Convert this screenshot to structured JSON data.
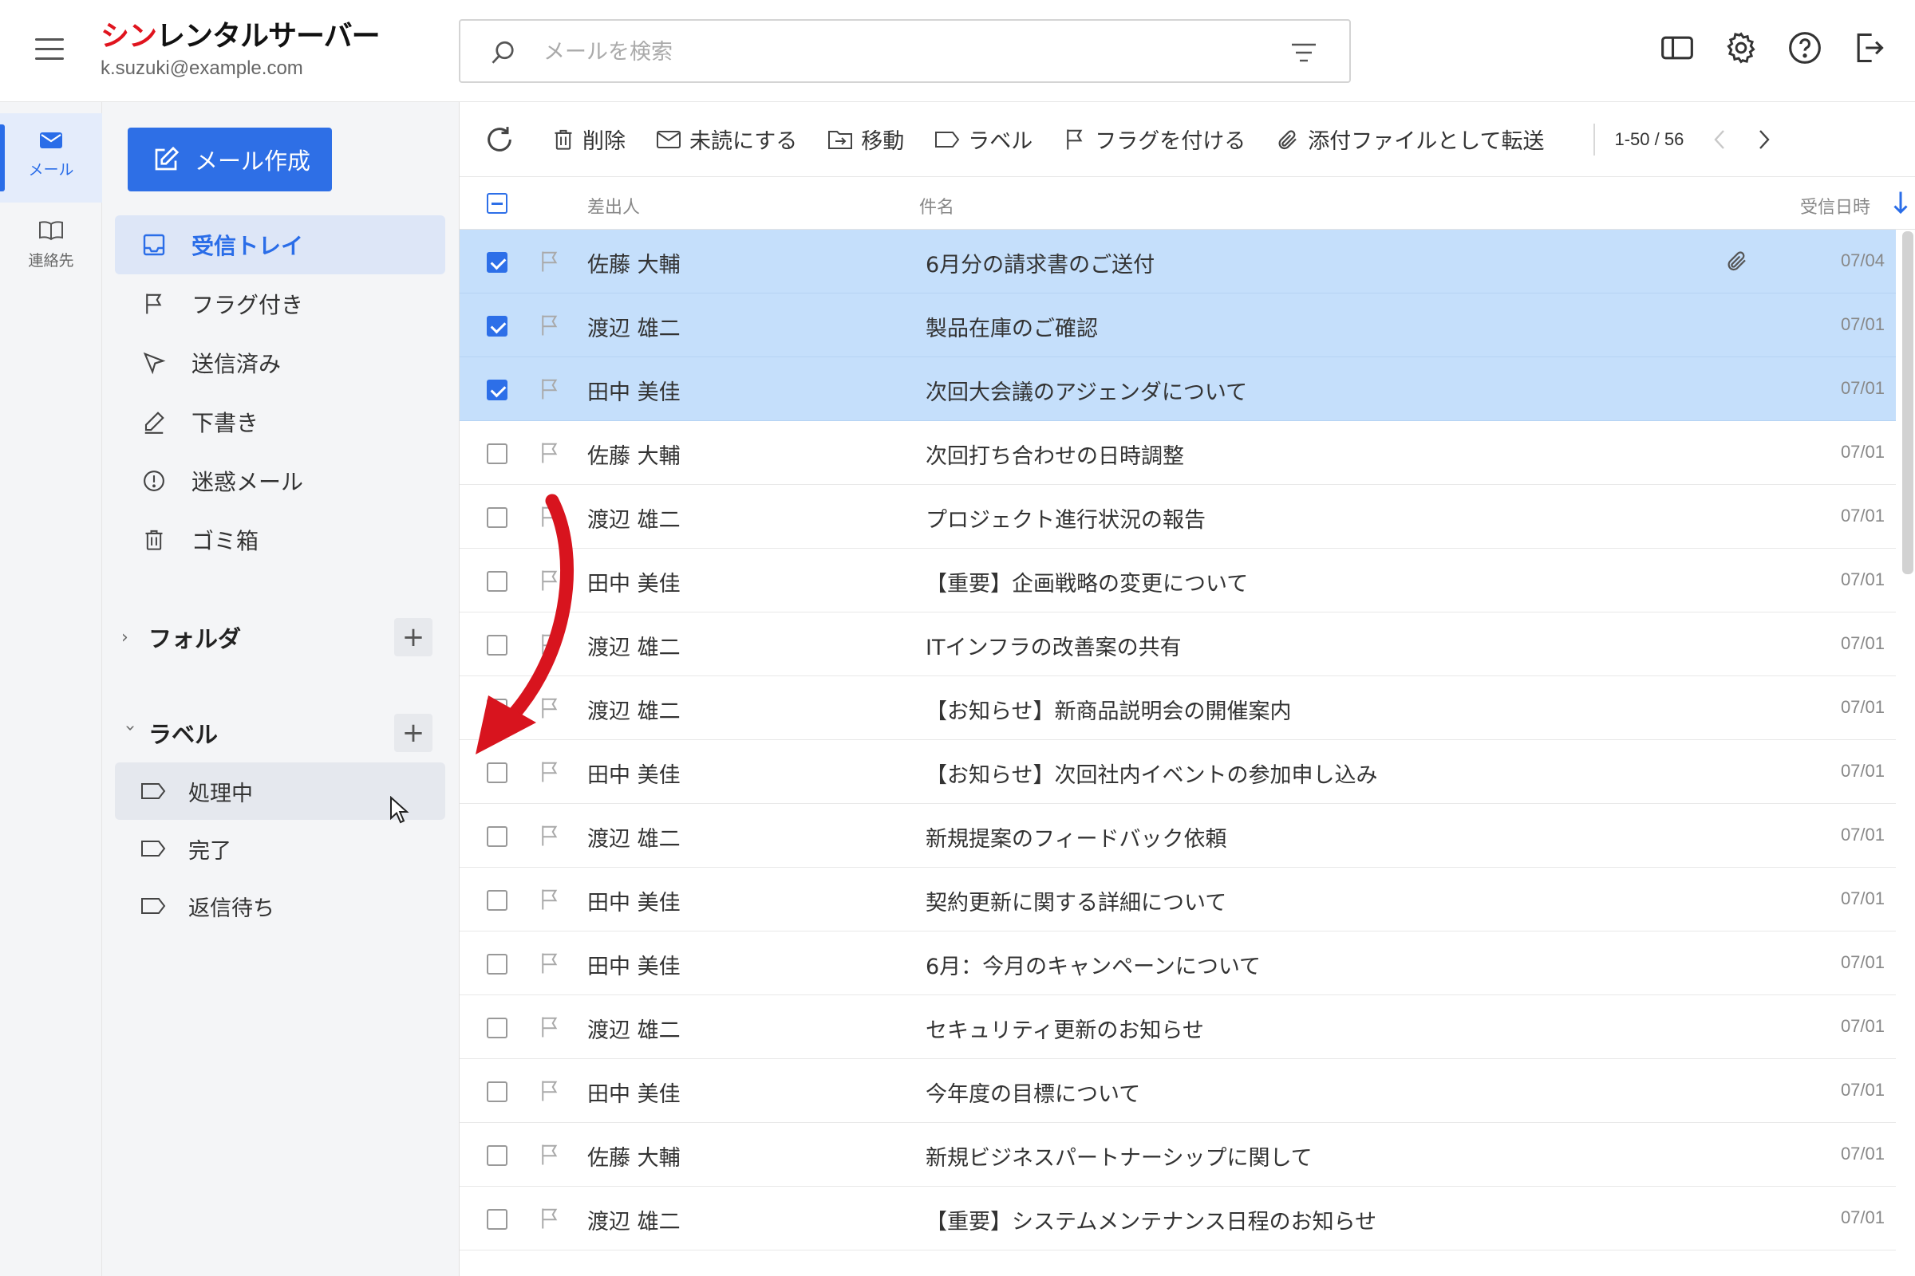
{
  "header": {
    "logo_red": "シン",
    "logo_rest": "レンタルサーバー",
    "account": "k.suzuki@example.com",
    "search_placeholder": "メールを検索"
  },
  "rail": {
    "items": [
      {
        "label": "メール",
        "icon": "mail-icon",
        "active": true
      },
      {
        "label": "連絡先",
        "icon": "book-icon",
        "active": false
      }
    ]
  },
  "sidebar": {
    "compose_label": "メール作成",
    "nav": [
      {
        "label": "受信トレイ",
        "icon": "inbox-icon"
      },
      {
        "label": "フラグ付き",
        "icon": "flag-icon"
      },
      {
        "label": "送信済み",
        "icon": "send-icon"
      },
      {
        "label": "下書き",
        "icon": "pencil-icon"
      },
      {
        "label": "迷惑メール",
        "icon": "alert-icon"
      },
      {
        "label": "ゴミ箱",
        "icon": "trash-icon"
      }
    ],
    "folders_label": "フォルダ",
    "labels_label": "ラベル",
    "labels": [
      {
        "label": "処理中",
        "icon": "label-tag-icon"
      },
      {
        "label": "完了",
        "icon": "label-tag-icon"
      },
      {
        "label": "返信待ち",
        "icon": "label-tag-icon"
      }
    ]
  },
  "toolbar": {
    "delete": "削除",
    "mark_unread": "未読にする",
    "move": "移動",
    "label": "ラベル",
    "flag": "フラグを付ける",
    "forward_attachment": "添付ファイルとして転送",
    "pager": "1-50 / 56"
  },
  "list": {
    "columns": {
      "sender": "差出人",
      "subject": "件名",
      "date": "受信日時"
    },
    "rows": [
      {
        "sender": "佐藤 大輔",
        "subject": "6月分の請求書のご送付",
        "date": "07/04",
        "selected": true,
        "attachment": true
      },
      {
        "sender": "渡辺 雄二",
        "subject": "製品在庫のご確認",
        "date": "07/01",
        "selected": true,
        "attachment": false
      },
      {
        "sender": "田中 美佳",
        "subject": "次回大会議のアジェンダについて",
        "date": "07/01",
        "selected": true,
        "attachment": false
      },
      {
        "sender": "佐藤 大輔",
        "subject": "次回打ち合わせの日時調整",
        "date": "07/01",
        "selected": false,
        "attachment": false
      },
      {
        "sender": "渡辺 雄二",
        "subject": "プロジェクト進行状況の報告",
        "date": "07/01",
        "selected": false,
        "attachment": false
      },
      {
        "sender": "田中 美佳",
        "subject": "【重要】企画戦略の変更について",
        "date": "07/01",
        "selected": false,
        "attachment": false
      },
      {
        "sender": "渡辺 雄二",
        "subject": "ITインフラの改善案の共有",
        "date": "07/01",
        "selected": false,
        "attachment": false
      },
      {
        "sender": "渡辺 雄二",
        "subject": "【お知らせ】新商品説明会の開催案内",
        "date": "07/01",
        "selected": false,
        "attachment": false
      },
      {
        "sender": "田中 美佳",
        "subject": "【お知らせ】次回社内イベントの参加申し込み",
        "date": "07/01",
        "selected": false,
        "attachment": false
      },
      {
        "sender": "渡辺 雄二",
        "subject": "新規提案のフィードバック依頼",
        "date": "07/01",
        "selected": false,
        "attachment": false
      },
      {
        "sender": "田中 美佳",
        "subject": "契約更新に関する詳細について",
        "date": "07/01",
        "selected": false,
        "attachment": false
      },
      {
        "sender": "田中 美佳",
        "subject": "6月：今月のキャンペーンについて",
        "date": "07/01",
        "selected": false,
        "attachment": false
      },
      {
        "sender": "渡辺 雄二",
        "subject": "セキュリティ更新のお知らせ",
        "date": "07/01",
        "selected": false,
        "attachment": false
      },
      {
        "sender": "田中 美佳",
        "subject": "今年度の目標について",
        "date": "07/01",
        "selected": false,
        "attachment": false
      },
      {
        "sender": "佐藤 大輔",
        "subject": "新規ビジネスパートナーシップに関して",
        "date": "07/01",
        "selected": false,
        "attachment": false
      },
      {
        "sender": "渡辺 雄二",
        "subject": "【重要】システムメンテナンス日程のお知らせ",
        "date": "07/01",
        "selected": false,
        "attachment": false
      }
    ]
  },
  "colors": {
    "accent": "#2e6fe6",
    "selected_row": "#c5dffb",
    "logo_red": "#e0141e",
    "annotation_arrow": "#d8141e"
  }
}
